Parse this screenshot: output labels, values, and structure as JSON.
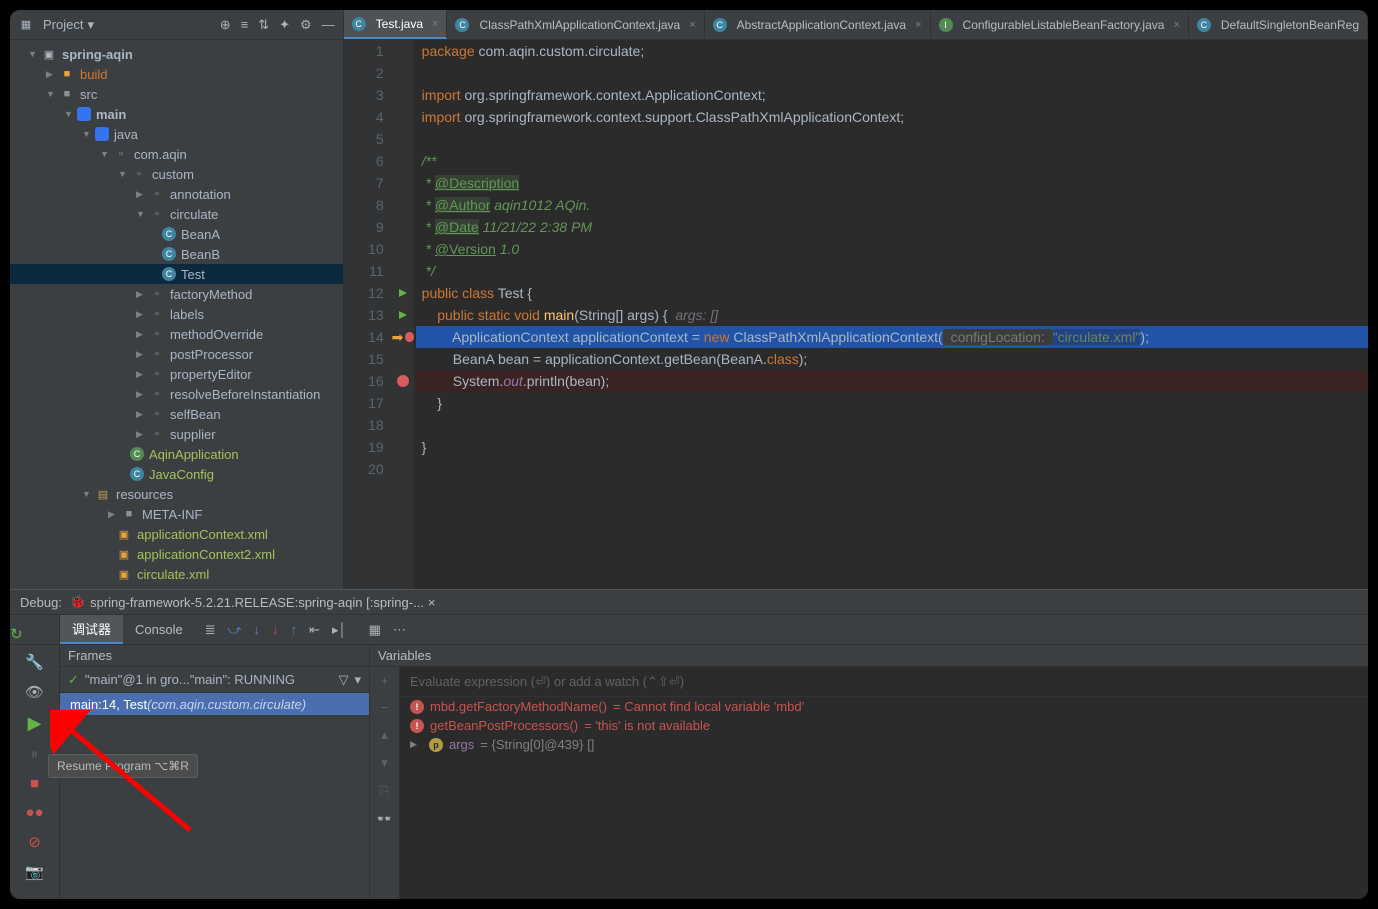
{
  "sidebar": {
    "title": "Project",
    "tree": {
      "root": "spring-aqin",
      "build": "build",
      "src": "src",
      "main": "main",
      "java": "java",
      "pkg_aqin": "com.aqin",
      "custom": "custom",
      "annotation": "annotation",
      "circulate": "circulate",
      "beanA": "BeanA",
      "beanB": "BeanB",
      "test": "Test",
      "factoryMethod": "factoryMethod",
      "labels": "labels",
      "methodOverride": "methodOverride",
      "postProcessor": "postProcessor",
      "propertyEditor": "propertyEditor",
      "resolveBefore": "resolveBeforeInstantiation",
      "selfBean": "selfBean",
      "supplier": "supplier",
      "aqinApp": "AqinApplication",
      "javaConfig": "JavaConfig",
      "resources": "resources",
      "metainf": "META-INF",
      "appctx": "applicationContext.xml",
      "appctx2": "applicationContext2.xml",
      "circ_xml": "circulate.xml"
    }
  },
  "tabs": [
    {
      "label": "Test.java",
      "active": true
    },
    {
      "label": "ClassPathXmlApplicationContext.java",
      "active": false
    },
    {
      "label": "AbstractApplicationContext.java",
      "active": false
    },
    {
      "label": "ConfigurableListableBeanFactory.java",
      "active": false
    },
    {
      "label": "DefaultSingletonBeanReg",
      "active": false
    }
  ],
  "code": {
    "l1": "package com.aqin.custom.circulate;",
    "l3a": "import ",
    "l3b": "org.springframework.context.ApplicationContext;",
    "l4a": "import ",
    "l4b": "org.springframework.context.support.ClassPathXmlApplicationContext;",
    "l6": "/**",
    "l7a": " * ",
    "l7t": "@Description",
    "l8a": " * ",
    "l8t": "@Author",
    "l8b": " aqin1012 AQin.",
    "l9a": " * ",
    "l9t": "@Date",
    "l9b": " 11/21/22 2:38 PM",
    "l10a": " * ",
    "l10t": "@Version",
    "l10b": " 1.0",
    "l11": " */",
    "l12a": "public class ",
    "l12b": "Test {",
    "l13a": "    public static void ",
    "l13m": "main",
    "l13b": "(String[] args) {",
    "l13hint": "  args: []",
    "l14a": "        ApplicationContext applicationContext = ",
    "l14n": "new ",
    "l14c": "ClassPathXmlApplicationContext(",
    "l14h": " configLocation: ",
    "l14s": "\"circulate.xml\"",
    "l14e": ");",
    "l15a": "        BeanA bean = applicationContext.getBean(BeanA.",
    "l15k": "class",
    "l15e": ");",
    "l16a": "        System.",
    "l16o": "out",
    "l16b": ".println(bean);",
    "l17": "    }",
    "l19": "}"
  },
  "debug": {
    "title": "Debug:",
    "config": "spring-framework-5.2.21.RELEASE:spring-aqin [:spring-...",
    "tabs": {
      "debugger": "调试器",
      "console": "Console"
    },
    "frames_hdr": "Frames",
    "vars_hdr": "Variables",
    "thread": "\"main\"@1 in gro...\"main\": RUNNING",
    "frame": {
      "loc": "main:14, Test ",
      "pkg": "(com.aqin.custom.circulate)"
    },
    "eval_placeholder": "Evaluate expression (⏎) or add a watch (⌃⇧⏎)",
    "vars": [
      {
        "badge": "!",
        "type": "err",
        "name": "mbd.getFactoryMethodName()",
        "val": " = Cannot find local variable 'mbd'"
      },
      {
        "badge": "!",
        "type": "err",
        "name": "getBeanPostProcessors()",
        "val": " = 'this' is not available"
      },
      {
        "badge": "p",
        "type": "p",
        "name": "args",
        "val": " = {String[0]@439} []"
      }
    ],
    "tooltip": "Resume Program ⌥⌘R"
  }
}
